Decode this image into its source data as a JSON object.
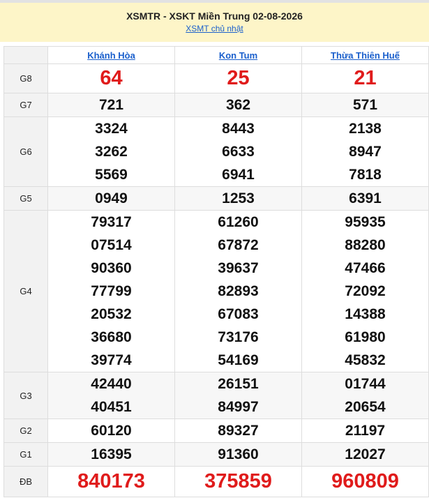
{
  "header": {
    "title": "XSMTR - XSKT Miền Trung 02-08-2026",
    "sublink": "XSMT chủ nhật"
  },
  "provinces": [
    "Khánh Hòa",
    "Kon Tum",
    "Thừa Thiên Huế"
  ],
  "prizes": [
    {
      "label": "G8",
      "style": "red",
      "values": [
        [
          "64"
        ],
        [
          "25"
        ],
        [
          "21"
        ]
      ]
    },
    {
      "label": "G7",
      "values": [
        [
          "721"
        ],
        [
          "362"
        ],
        [
          "571"
        ]
      ]
    },
    {
      "label": "G6",
      "values": [
        [
          "3324",
          "3262",
          "5569"
        ],
        [
          "8443",
          "6633",
          "6941"
        ],
        [
          "2138",
          "8947",
          "7818"
        ]
      ]
    },
    {
      "label": "G5",
      "values": [
        [
          "0949"
        ],
        [
          "1253"
        ],
        [
          "6391"
        ]
      ]
    },
    {
      "label": "G4",
      "values": [
        [
          "79317",
          "07514",
          "90360",
          "77799",
          "20532",
          "36680",
          "39774"
        ],
        [
          "61260",
          "67872",
          "39637",
          "82893",
          "67083",
          "73176",
          "54169"
        ],
        [
          "95935",
          "88280",
          "47466",
          "72092",
          "14388",
          "61980",
          "45832"
        ]
      ]
    },
    {
      "label": "G3",
      "values": [
        [
          "42440",
          "40451"
        ],
        [
          "26151",
          "84997"
        ],
        [
          "01744",
          "20654"
        ]
      ]
    },
    {
      "label": "G2",
      "values": [
        [
          "60120"
        ],
        [
          "89327"
        ],
        [
          "21197"
        ]
      ]
    },
    {
      "label": "G1",
      "values": [
        [
          "16395"
        ],
        [
          "91360"
        ],
        [
          "12027"
        ]
      ]
    },
    {
      "label": "ĐB",
      "style": "red",
      "values": [
        [
          "840173"
        ],
        [
          "375859"
        ],
        [
          "960809"
        ]
      ]
    }
  ],
  "colors": {
    "red": "#e01b1b",
    "link": "#1a5fcc",
    "header_bg": "#fdf5c8"
  }
}
